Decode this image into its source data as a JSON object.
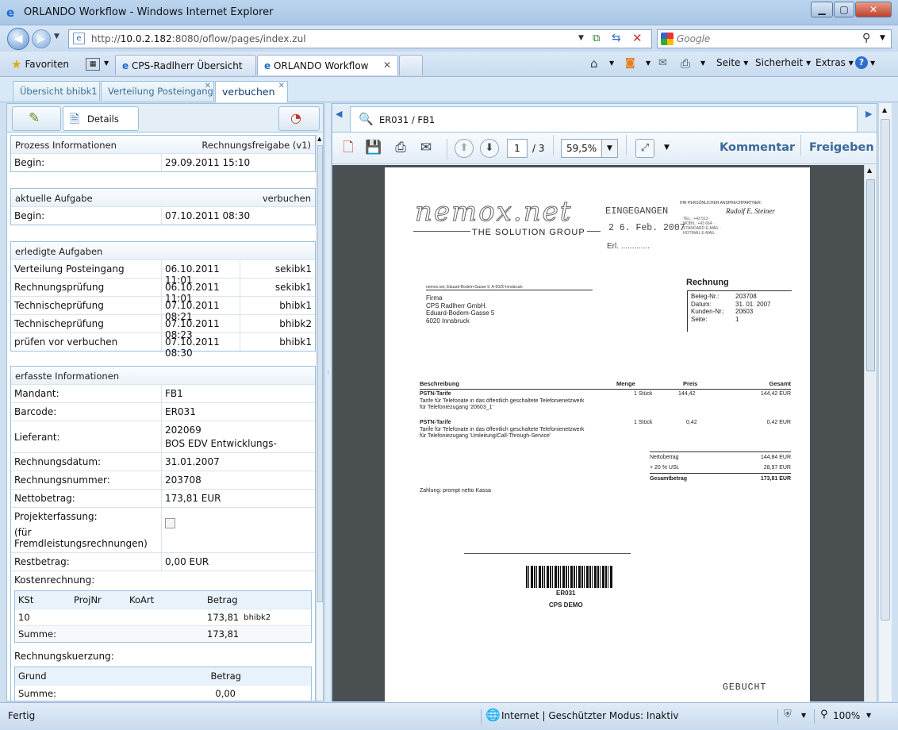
{
  "window": {
    "title": "ORLANDO Workflow - Windows Internet Explorer"
  },
  "nav": {
    "url_prefix": "http://",
    "url_host": "10.0.2.182",
    "url_rest": ":8080/oflow/pages/index.zul",
    "search_placeholder": "Google"
  },
  "browser_tabs": {
    "favorites": "Favoriten",
    "tabs": [
      "CPS-Radlherr Übersicht",
      "ORLANDO Workflow"
    ],
    "commands": [
      "Seite",
      "Sicherheit",
      "Extras"
    ]
  },
  "app_tabs": [
    "Übersicht bhibk1",
    "Verteilung Posteingang",
    "verbuchen"
  ],
  "left": {
    "details_label": "Details",
    "prozess": {
      "title": "Prozess Informationen",
      "value": "Rechnungsfreigabe (v1)",
      "begin_label": "Begin:",
      "begin_value": "29.09.2011 15:10"
    },
    "aktuelle": {
      "title": "aktuelle Aufgabe",
      "value": "verbuchen",
      "begin_label": "Begin:",
      "begin_value": "07.10.2011 08:30"
    },
    "erledigte": {
      "title": "erledigte Aufgaben",
      "rows": [
        {
          "task": "Verteilung Posteingang",
          "date": "06.10.2011 11:01",
          "user": "sekibk1"
        },
        {
          "task": "Rechnungsprüfung",
          "date": "06.10.2011 11:01",
          "user": "sekibk1"
        },
        {
          "task": "Technischeprüfung",
          "date": "07.10.2011 08:21",
          "user": "bhibk1"
        },
        {
          "task": "Technischeprüfung",
          "date": "07.10.2011 08:23",
          "user": "bhibk2"
        },
        {
          "task": "prüfen vor verbuchen",
          "date": "07.10.2011 08:30",
          "user": "bhibk1"
        }
      ]
    },
    "erfasste": {
      "title": "erfasste Informationen",
      "mandant_l": "Mandant:",
      "mandant_v": "FB1",
      "barcode_l": "Barcode:",
      "barcode_v": "ER031",
      "lieferant_l": "Lieferant:",
      "lieferant_v1": "202069",
      "lieferant_v2": "BOS EDV Entwicklungs-",
      "rdatum_l": "Rechnungsdatum:",
      "rdatum_v": "31.01.2007",
      "rnummer_l": "Rechnungsnummer:",
      "rnummer_v": "203708",
      "netto_l": "Nettobetrag:",
      "netto_v": "173,81 EUR",
      "projekt_l1": "Projekterfassung:",
      "projekt_l2": "(für Fremdleistungsrechnungen)",
      "rest_l": "Restbetrag:",
      "rest_v": "0,00 EUR",
      "kosten_l": "Kostenrechnung:",
      "kosten_head": [
        "KSt",
        "ProjNr",
        "KoArt",
        "Betrag"
      ],
      "kosten_row": {
        "kst": "10",
        "betrag": "173,81",
        "user": "bhibk2"
      },
      "kosten_sum_l": "Summe:",
      "kosten_sum_v": "173,81",
      "kuerz_l": "Rechnungskuerzung:",
      "kuerz_head": [
        "Grund",
        "Betrag"
      ],
      "kuerz_sum_l": "Summe:",
      "kuerz_sum_v": "0,00"
    }
  },
  "doc": {
    "tab_label": "ER031 / FB1",
    "page_current": "1",
    "page_total": "/ 3",
    "zoom": "59,5%",
    "kommentar": "Kommentar",
    "freigeben": "Freigeben"
  },
  "invoice": {
    "logo": "nemox.net",
    "tagline": "THE SOLUTION GROUP",
    "stamp1": "EINGEGANGEN",
    "stamp2": "2 6. Feb. 2007",
    "stamp3": "Erl.",
    "contact_head": "IHR PERSÖNLICHER ANSPRECHPARTNER:",
    "contact_name": "Rudolf E. Steiner",
    "sender_line": "nemox.net, Eduard-Bodem-Gasse 9, A-6020 Innsbruck",
    "addr": [
      "Firma",
      "CPS Radlherr GmbH.",
      "Eduard-Bodem-Gasse 5",
      "6020 Innsbruck"
    ],
    "title": "Rechnung",
    "meta_l": [
      "Beleg-Nr.:",
      "Datum:",
      "Kunden-Nr.:",
      "Seite:"
    ],
    "meta_v": [
      "203708",
      "31. 01. 2007",
      "20603",
      "1"
    ],
    "th": [
      "Beschreibung",
      "Menge",
      "Preis",
      "Gesamt"
    ],
    "items": [
      {
        "name": "PSTN-Tarife",
        "d1": "Tarife für Telefonate in das öffentlich geschaltete Telefonienetzwerk",
        "d2": "für Telefoniezugang '20603_1'",
        "menge": "1 Stück",
        "preis": "144,42",
        "gesamt": "144,42 EUR"
      },
      {
        "name": "PSTN-Tarife",
        "d1": "Tarife für Telefonate in das öffentlich geschaltete Telefonienetzwerk",
        "d2": "für Telefoniezugang 'Umleitung/Call-Through-Service'",
        "menge": "1 Stück",
        "preis": "0,42",
        "gesamt": "0,42 EUR"
      }
    ],
    "tot_l": [
      "Nettobetrag",
      "+ 20 % USt.",
      "Gesamtbetrag"
    ],
    "tot_v": [
      "144,84 EUR",
      "28,97 EUR",
      "173,81 EUR"
    ],
    "zahlung": "Zahlung: prompt netto Kassa",
    "barcode_text": "ER031",
    "barcode_sub": "CPS DEMO",
    "gebucht": "GEBUCHT"
  },
  "status": {
    "left": "Fertig",
    "zone": "Internet | Geschützter Modus: Inaktiv",
    "zoom": "100%"
  }
}
